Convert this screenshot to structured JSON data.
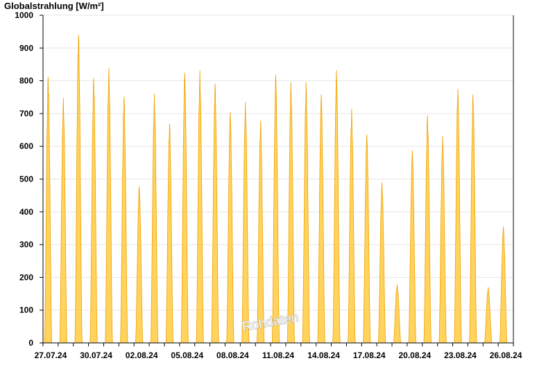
{
  "chart_data": {
    "type": "area",
    "title": "",
    "ylabel": "Globalstrahlung [W/m²]",
    "xlabel": "",
    "ylim": [
      0,
      1000
    ],
    "yticks": [
      0,
      100,
      200,
      300,
      400,
      500,
      600,
      700,
      800,
      900,
      1000
    ],
    "xlim": [
      "27.07.24 00:00",
      "27.08.24 00:00"
    ],
    "xticks": [
      "27.07.24",
      "30.07.24",
      "02.08.24",
      "05.08.24",
      "08.08.24",
      "11.08.24",
      "14.08.24",
      "17.08.24",
      "20.08.24",
      "23.08.24",
      "26.08.24"
    ],
    "grid": true,
    "watermark": "Rohdaten",
    "series": [
      {
        "values_note_unit": "W/m²",
        "daily_peaks": [
          {
            "date": "27.07.24",
            "peak": 812
          },
          {
            "date": "28.07.24",
            "peak": 748
          },
          {
            "date": "29.07.24",
            "peak": 940
          },
          {
            "date": "30.07.24",
            "peak": 808
          },
          {
            "date": "31.07.24",
            "peak": 840
          },
          {
            "date": "01.08.24",
            "peak": 752
          },
          {
            "date": "02.08.24",
            "peak": 478
          },
          {
            "date": "03.08.24",
            "peak": 760
          },
          {
            "date": "04.08.24",
            "peak": 670
          },
          {
            "date": "05.08.24",
            "peak": 825
          },
          {
            "date": "06.08.24",
            "peak": 832
          },
          {
            "date": "07.08.24",
            "peak": 792
          },
          {
            "date": "08.08.24",
            "peak": 705
          },
          {
            "date": "09.08.24",
            "peak": 735
          },
          {
            "date": "10.08.24",
            "peak": 678
          },
          {
            "date": "11.08.24",
            "peak": 818
          },
          {
            "date": "12.08.24",
            "peak": 797
          },
          {
            "date": "13.08.24",
            "peak": 795
          },
          {
            "date": "14.08.24",
            "peak": 758
          },
          {
            "date": "15.08.24",
            "peak": 832
          },
          {
            "date": "16.08.24",
            "peak": 715
          },
          {
            "date": "17.08.24",
            "peak": 636
          },
          {
            "date": "18.08.24",
            "peak": 490
          },
          {
            "date": "19.08.24",
            "peak": 178
          },
          {
            "date": "20.08.24",
            "peak": 588
          },
          {
            "date": "21.08.24",
            "peak": 695
          },
          {
            "date": "22.08.24",
            "peak": 632
          },
          {
            "date": "23.08.24",
            "peak": 775
          },
          {
            "date": "24.08.24",
            "peak": 758
          },
          {
            "date": "25.08.24",
            "peak": 170
          },
          {
            "date": "26.08.24",
            "peak": 355
          }
        ]
      }
    ],
    "colors": {
      "fill": "#ffd35c",
      "stroke": "#f0a000",
      "grid": "#e6e6e6",
      "axis": "#000000"
    }
  }
}
